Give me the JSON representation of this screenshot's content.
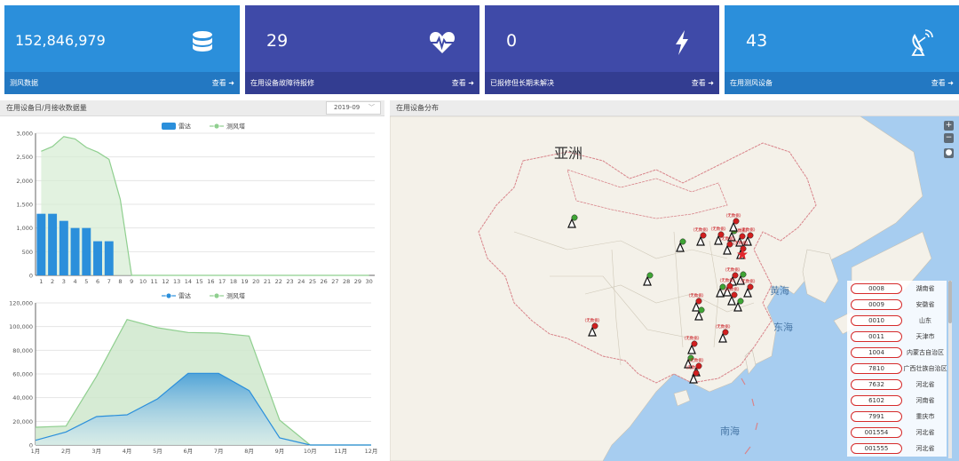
{
  "cards": [
    {
      "value": "152,846,979",
      "label": "测风数据",
      "link": "查看 ➜",
      "color": "#2b8fdb",
      "footer_color": "#2378c2",
      "icon": "database-icon"
    },
    {
      "value": "29",
      "label": "在用设备故障待报修",
      "link": "查看 ➜",
      "color": "#3f4aa8",
      "footer_color": "#333d91",
      "icon": "heartbeat-icon"
    },
    {
      "value": "0",
      "label": "已报修但长期未解决",
      "link": "查看 ➜",
      "color": "#3f4aa8",
      "footer_color": "#333d91",
      "icon": "bolt-icon"
    },
    {
      "value": "43",
      "label": "在用测风设备",
      "link": "查看 ➜",
      "color": "#2b8fdb",
      "footer_color": "#2378c2",
      "icon": "satellite-dish-icon"
    }
  ],
  "left_panel": {
    "title": "在用设备日/月接收数据量",
    "select_value": "2019-09"
  },
  "map_panel": {
    "title": "在用设备分布",
    "labels": {
      "asia": "亚洲",
      "yellow_sea": "黄海",
      "east_sea": "东海",
      "south_sea": "南海"
    },
    "marker_text": "(无数据)",
    "legend": [
      {
        "code": "0008",
        "province": "湖南省"
      },
      {
        "code": "0009",
        "province": "安徽省"
      },
      {
        "code": "0010",
        "province": "山东"
      },
      {
        "code": "0011",
        "province": "天津市"
      },
      {
        "code": "1004",
        "province": "内蒙古自治区"
      },
      {
        "code": "7810",
        "province": "广西壮族自治区"
      },
      {
        "code": "7632",
        "province": "河北省"
      },
      {
        "code": "6102",
        "province": "河南省"
      },
      {
        "code": "7991",
        "province": "重庆市"
      },
      {
        "code": "001554",
        "province": "河北省"
      },
      {
        "code": "001555",
        "province": "河北省"
      }
    ]
  },
  "chart_data": [
    {
      "type": "bar",
      "legend": [
        "雷达",
        "测风塔"
      ],
      "categories": [
        "1",
        "2",
        "3",
        "4",
        "5",
        "6",
        "7",
        "8",
        "9",
        "10",
        "11",
        "12",
        "13",
        "14",
        "15",
        "16",
        "17",
        "18",
        "19",
        "20",
        "21",
        "22",
        "23",
        "24",
        "25",
        "26",
        "27",
        "28",
        "29",
        "30"
      ],
      "series": [
        {
          "name": "雷达",
          "type": "bar",
          "color": "#2b8fdb",
          "values": [
            1300,
            1300,
            1150,
            1000,
            1000,
            720,
            720,
            0,
            0,
            0,
            0,
            0,
            0,
            0,
            0,
            0,
            0,
            0,
            0,
            0,
            0,
            0,
            0,
            0,
            0,
            0,
            0,
            0,
            0,
            0
          ]
        },
        {
          "name": "测风塔",
          "type": "area",
          "color": "#8fcf8f",
          "values": [
            2620,
            2720,
            2930,
            2880,
            2700,
            2600,
            2450,
            1600,
            0,
            0,
            0,
            0,
            0,
            0,
            0,
            0,
            0,
            0,
            0,
            0,
            0,
            0,
            0,
            0,
            0,
            0,
            0,
            0,
            0,
            0
          ]
        }
      ],
      "yticks": [
        "0",
        "500",
        "1,000",
        "1,500",
        "2,000",
        "2,500",
        "3,000"
      ],
      "ylim": [
        0,
        3000
      ]
    },
    {
      "type": "area",
      "legend": [
        "雷达",
        "测风塔"
      ],
      "categories": [
        "1月",
        "2月",
        "3月",
        "4月",
        "5月",
        "6月",
        "7月",
        "8月",
        "9月",
        "10月",
        "11月",
        "12月"
      ],
      "series": [
        {
          "name": "雷达",
          "color": "#2b8fdb",
          "values": [
            4000,
            11000,
            24000,
            25500,
            39000,
            60500,
            60500,
            46000,
            6000,
            0,
            0,
            0
          ]
        },
        {
          "name": "测风塔",
          "color": "#8fcf8f",
          "values": [
            15000,
            16000,
            58000,
            106000,
            99000,
            95000,
            94500,
            92000,
            21000,
            0,
            0,
            0
          ]
        }
      ],
      "yticks": [
        "0",
        "20,000",
        "40,000",
        "60,000",
        "80,000",
        "100,000",
        "120,000"
      ],
      "ylim": [
        0,
        120000
      ]
    }
  ]
}
